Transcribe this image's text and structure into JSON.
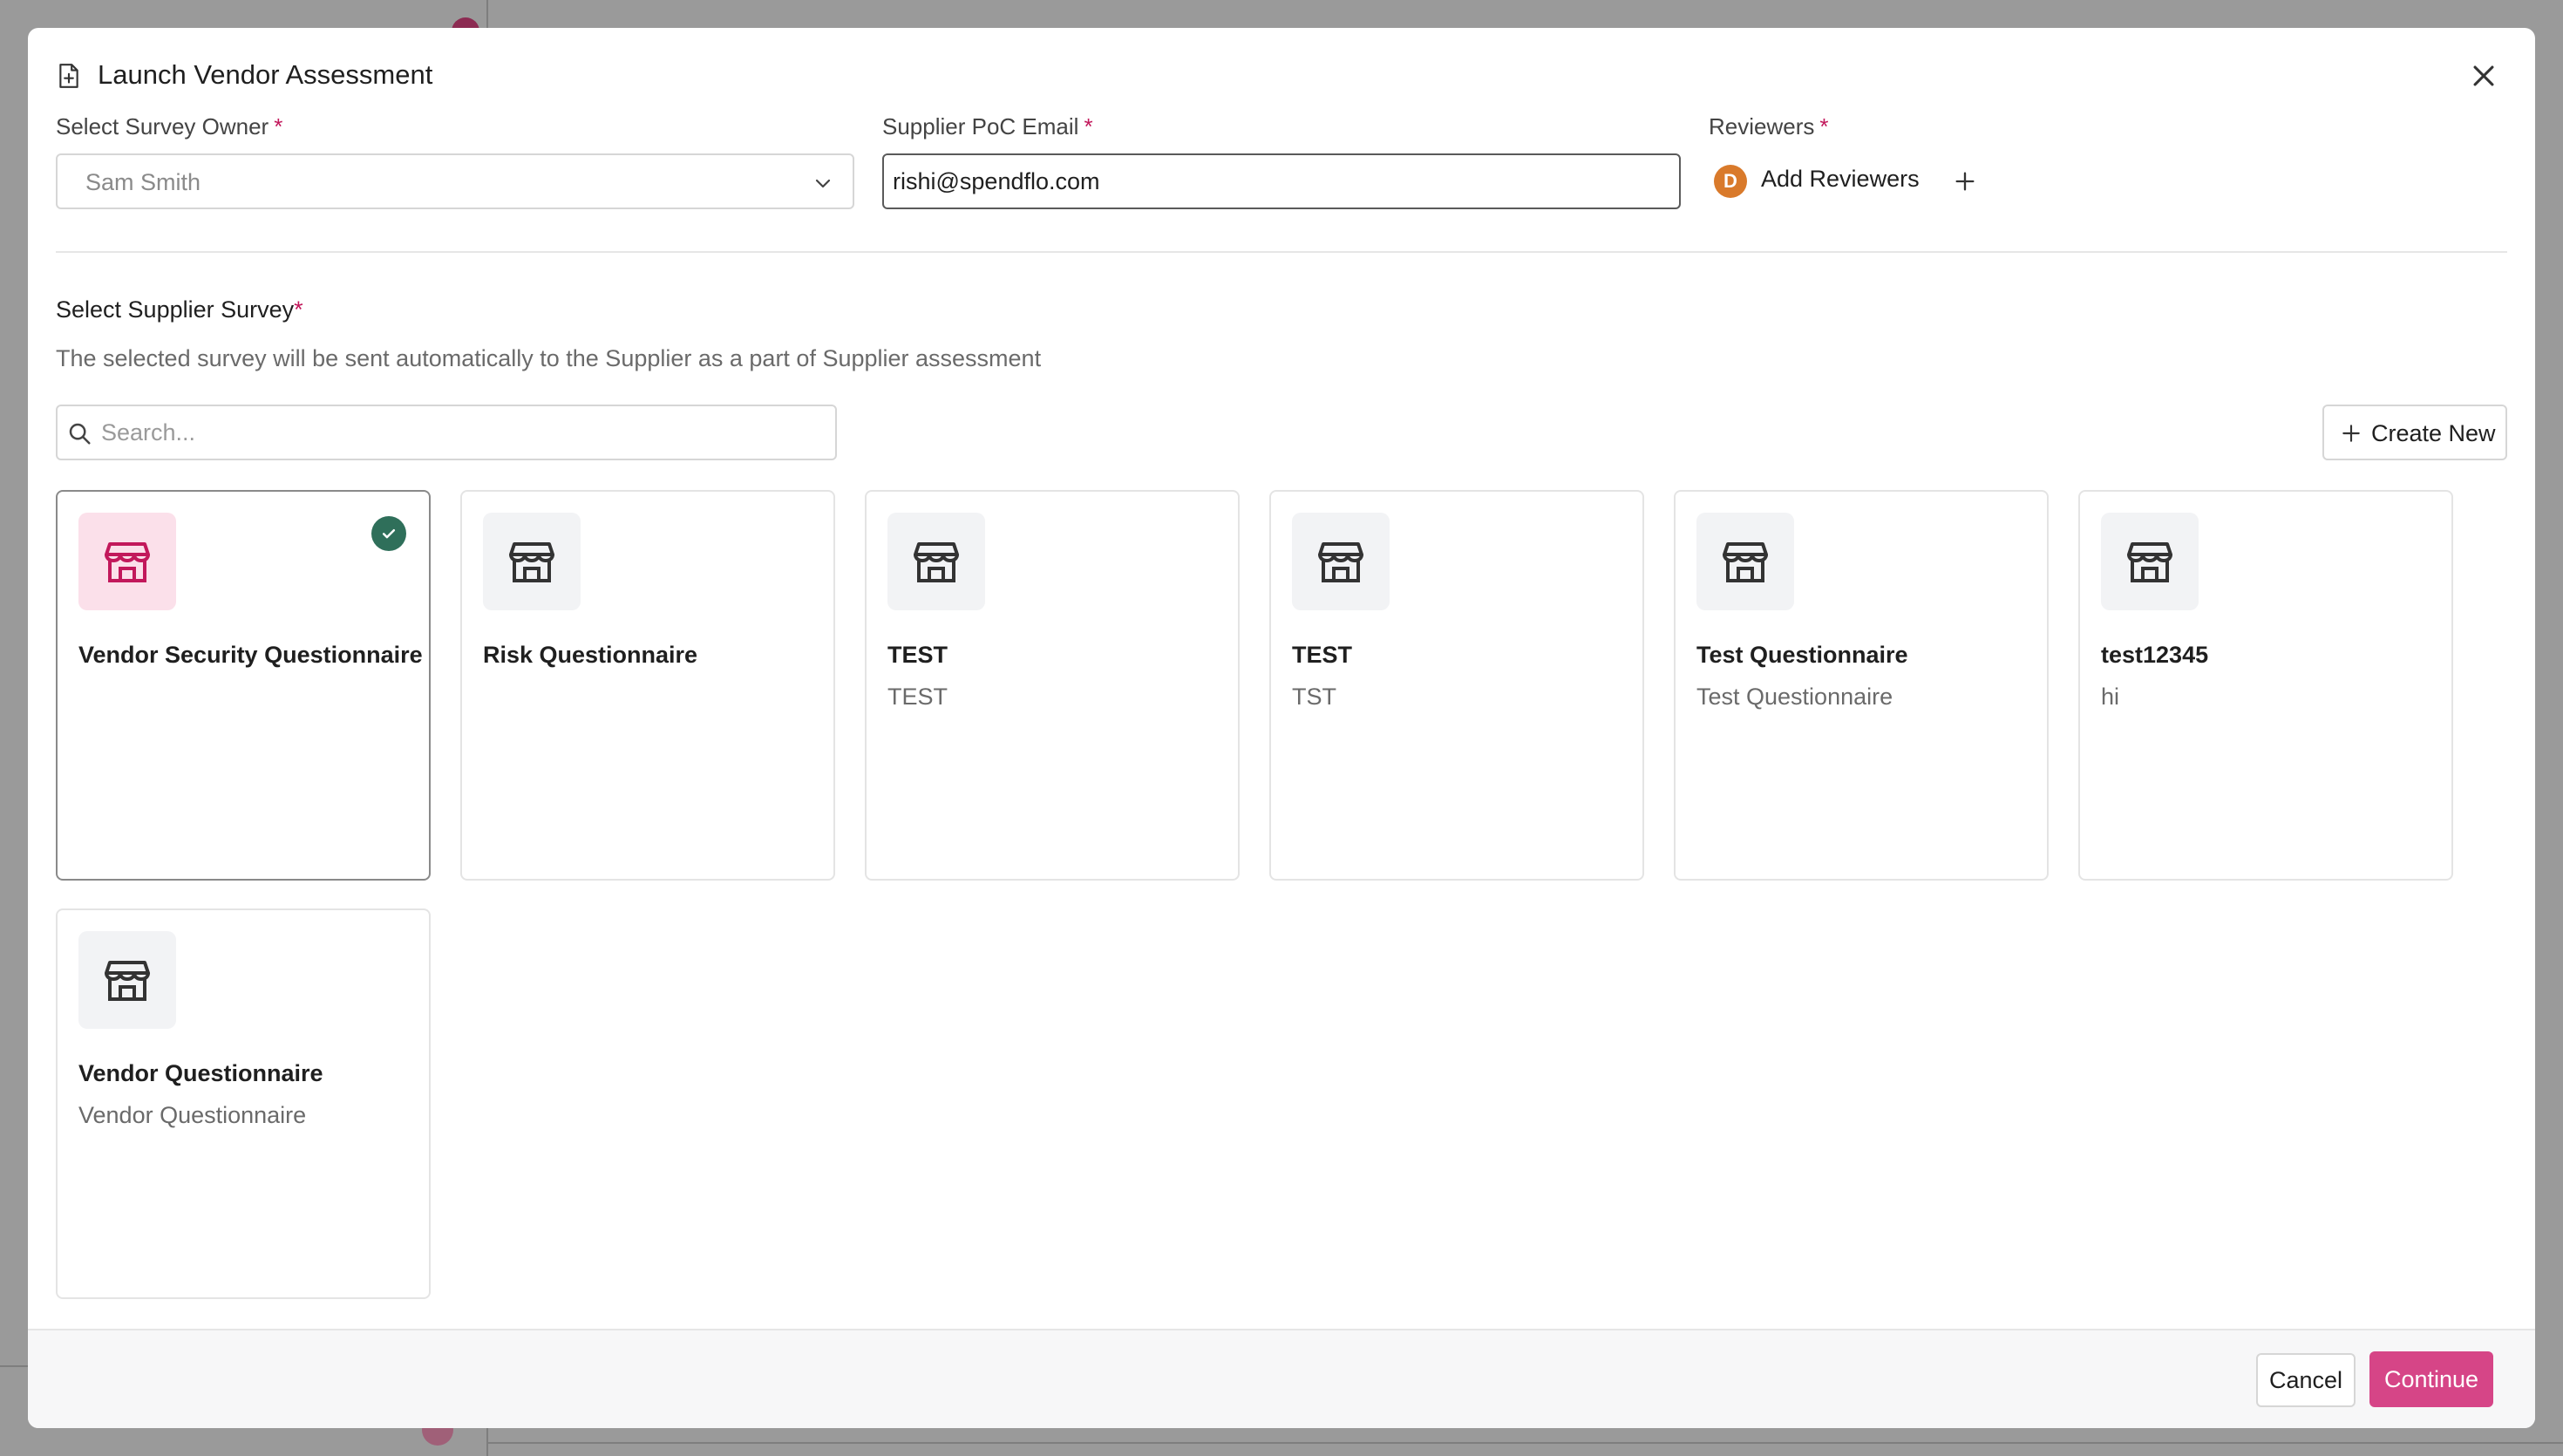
{
  "modal": {
    "title": "Launch Vendor Assessment"
  },
  "survey_owner": {
    "label": "Select Survey Owner",
    "required_mark": "*",
    "value": "Sam Smith"
  },
  "supplier_email": {
    "label": "Supplier PoC Email",
    "required_mark": "*",
    "value": "rishi@spendflo.com"
  },
  "reviewers": {
    "label": "Reviewers",
    "required_mark": "*",
    "avatar_initial": "D",
    "add_label": "Add Reviewers"
  },
  "survey_section": {
    "title": "Select Supplier Survey",
    "required_mark": "*",
    "description": "The selected survey will be sent automatically to the Supplier as a part of Supplier assessment",
    "search_placeholder": "Search...",
    "create_label": "Create New"
  },
  "surveys": [
    {
      "title": "Vendor Security Questionnaire",
      "subtitle": "",
      "selected": true
    },
    {
      "title": "Risk Questionnaire",
      "subtitle": "",
      "selected": false
    },
    {
      "title": "TEST",
      "subtitle": "TEST",
      "selected": false
    },
    {
      "title": "TEST",
      "subtitle": "TST",
      "selected": false
    },
    {
      "title": "Test Questionnaire",
      "subtitle": "Test Questionnaire",
      "selected": false
    },
    {
      "title": "test12345",
      "subtitle": "hi",
      "selected": false
    },
    {
      "title": "Vendor Questionnaire",
      "subtitle": "Vendor Questionnaire",
      "selected": false
    }
  ],
  "footer": {
    "cancel_label": "Cancel",
    "continue_label": "Continue"
  },
  "colors": {
    "accent": "#d64587",
    "required": "#c2185b",
    "selected_check": "#2f6f5a",
    "selected_icon_bg": "#fbe0ea",
    "selected_icon": "#c2185b",
    "avatar": "#d97a2b"
  },
  "icons": {
    "title": "document-add-icon",
    "close": "close-icon",
    "chevron": "chevron-down-icon",
    "search": "search-icon",
    "plus": "plus-icon",
    "card": "store-icon",
    "check": "check-icon"
  }
}
